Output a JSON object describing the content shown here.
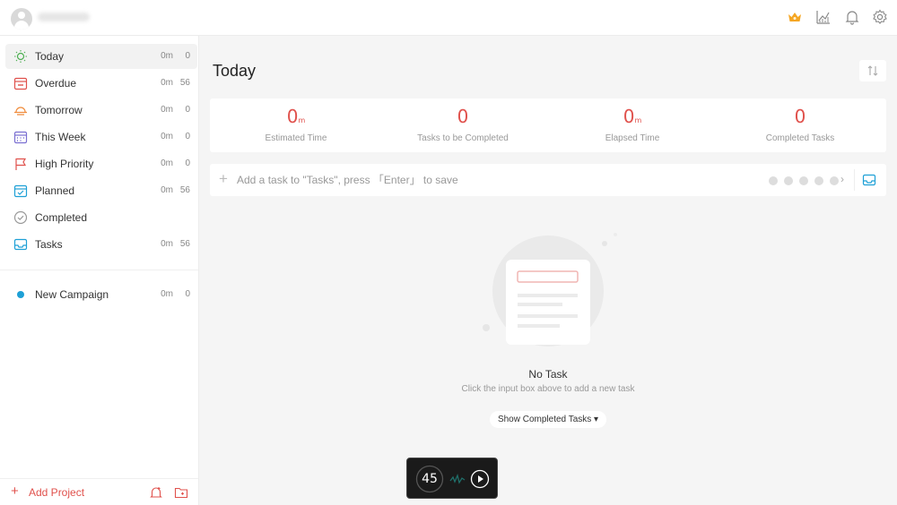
{
  "sidebar": {
    "items": [
      {
        "label": "Today",
        "time": "0m",
        "count": "0",
        "icon": "sun-icon",
        "color": "#4caf50"
      },
      {
        "label": "Overdue",
        "time": "0m",
        "count": "56",
        "icon": "overdue-calendar-icon",
        "color": "#e0514c"
      },
      {
        "label": "Tomorrow",
        "time": "0m",
        "count": "0",
        "icon": "sunset-icon",
        "color": "#f08c3c"
      },
      {
        "label": "This Week",
        "time": "0m",
        "count": "0",
        "icon": "week-calendar-icon",
        "color": "#7a6fd1"
      },
      {
        "label": "High Priority",
        "time": "0m",
        "count": "0",
        "icon": "flag-icon",
        "color": "#e0514c"
      },
      {
        "label": "Planned",
        "time": "0m",
        "count": "56",
        "icon": "planned-calendar-icon",
        "color": "#1ea0d6"
      },
      {
        "label": "Completed",
        "time": "",
        "count": "",
        "icon": "check-circle-icon",
        "color": "#999999"
      },
      {
        "label": "Tasks",
        "time": "0m",
        "count": "56",
        "icon": "inbox-icon",
        "color": "#1ea0d6"
      }
    ],
    "projects": [
      {
        "label": "New Campaign",
        "time": "0m",
        "count": "0",
        "color": "#1ea0d6"
      }
    ],
    "add_project_label": "Add Project"
  },
  "main": {
    "title": "Today",
    "stats": [
      {
        "value": "0",
        "unit": "m",
        "caption": "Estimated Time"
      },
      {
        "value": "0",
        "unit": "",
        "caption": "Tasks to be Completed"
      },
      {
        "value": "0",
        "unit": "m",
        "caption": "Elapsed Time"
      },
      {
        "value": "0",
        "unit": "",
        "caption": "Completed Tasks"
      }
    ],
    "add_task_placeholder": "Add a task to \"Tasks\", press 「Enter」 to save",
    "empty_title": "No Task",
    "empty_subtitle": "Click the input box above to add a new task",
    "show_completed_label": "Show Completed Tasks ▾"
  },
  "timer": {
    "value": "45"
  },
  "colors": {
    "accent": "#e0514c",
    "blue": "#1ea0d6",
    "premium": "#f5a623"
  }
}
